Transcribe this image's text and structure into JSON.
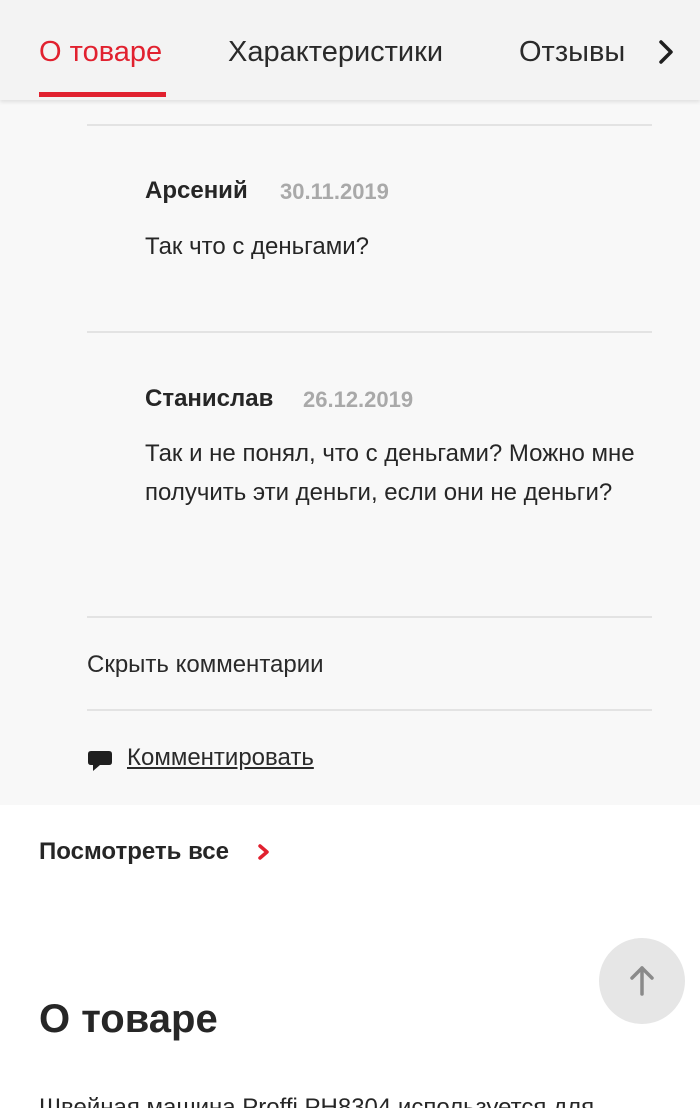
{
  "tabs": [
    {
      "label": "О товаре",
      "active": true
    },
    {
      "label": "Характеристики",
      "active": false
    },
    {
      "label": "Отзывы",
      "active": false
    }
  ],
  "comments": [
    {
      "author": "Арсений",
      "date": "30.11.2019",
      "text": "Так что с деньгами?"
    },
    {
      "author": "Станислав",
      "date": "26.12.2019",
      "text": "Так и не понял, что с деньгами? Можно мне получить эти деньги, если они не деньги?"
    }
  ],
  "actions": {
    "hide_comments": "Скрыть комментарии",
    "comment": "Комментировать",
    "see_all": "Посмотреть все"
  },
  "about": {
    "title": "О товаре",
    "description_start": "Швейная машина Proffi PH8304 используется для"
  },
  "colors": {
    "accent": "#e1212f",
    "tabbar_bg": "#f3f3f3",
    "comments_bg": "#f8f8f8",
    "date_gray": "#a9a9a9"
  },
  "icons": [
    "chevron-right-icon",
    "speech-bubble-icon",
    "arrow-up-icon"
  ]
}
